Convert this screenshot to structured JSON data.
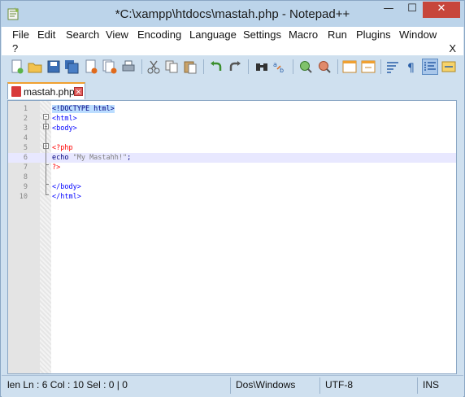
{
  "window": {
    "title": "*C:\\xampp\\htdocs\\mastah.php - Notepad++",
    "minimize": "—",
    "maximize": "☐",
    "close": "✕"
  },
  "menu": {
    "items": [
      "File",
      "Edit",
      "Search",
      "View",
      "Encoding",
      "Language",
      "Settings",
      "Macro",
      "Run",
      "Plugins",
      "Window",
      "?"
    ],
    "close_doc": "X"
  },
  "toolbar": {
    "icons": [
      "new-file-icon",
      "open-file-icon",
      "save-icon",
      "save-all-icon",
      "close-icon",
      "close-all-icon",
      "print-icon",
      "cut-icon",
      "copy-icon",
      "paste-icon",
      "undo-icon",
      "redo-icon",
      "find-icon",
      "replace-icon",
      "zoom-in-icon",
      "zoom-out-icon",
      "sync-vertical-icon",
      "sync-horizontal-icon",
      "word-wrap-icon",
      "show-all-chars-icon",
      "indent-guide-icon",
      "user-lang-icon"
    ]
  },
  "tabs": [
    {
      "label": "mastah.php",
      "active": true
    }
  ],
  "editor": {
    "lines": [
      {
        "n": "1",
        "tokens": [
          [
            "doctype",
            "<!DOCTYPE html>"
          ]
        ]
      },
      {
        "n": "2",
        "tokens": [
          [
            "tag",
            "<html>"
          ]
        ]
      },
      {
        "n": "3",
        "tokens": [
          [
            "tag",
            "<body>"
          ]
        ]
      },
      {
        "n": "4",
        "tokens": []
      },
      {
        "n": "5",
        "tokens": [
          [
            "php",
            "<?php"
          ]
        ]
      },
      {
        "n": "6",
        "tokens": [
          [
            "kw",
            "echo "
          ],
          [
            "str",
            "\"My Mastahh!\""
          ],
          [
            "dark",
            ";"
          ]
        ]
      },
      {
        "n": "7",
        "tokens": [
          [
            "php",
            "?>"
          ]
        ]
      },
      {
        "n": "8",
        "tokens": []
      },
      {
        "n": "9",
        "tokens": [
          [
            "tag",
            "</body>"
          ]
        ]
      },
      {
        "n": "10",
        "tokens": [
          [
            "tag",
            "</html>"
          ]
        ]
      }
    ],
    "current_line": 6
  },
  "status": {
    "position": "len Ln : 6    Col : 10    Sel : 0 | 0",
    "eol": "Dos\\Windows",
    "encoding": "UTF-8",
    "mode": "INS"
  },
  "colors": {
    "accent_tab": "#f0a030",
    "php_tag": "#ff0000",
    "html_tag": "#0000ff",
    "current_line": "#e8e8ff"
  }
}
